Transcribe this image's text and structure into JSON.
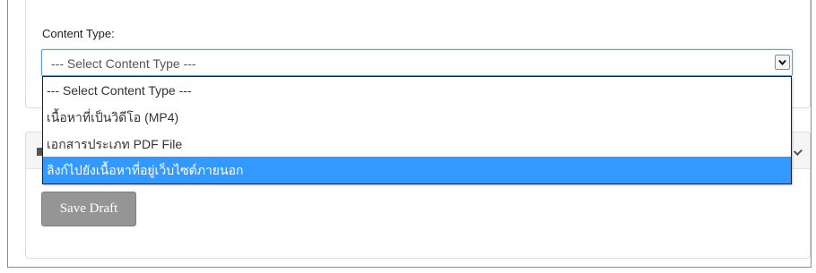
{
  "form": {
    "content_type_label": "Content Type:",
    "select_value": "--- Select Content Type ---",
    "options": [
      "--- Select Content Type ---",
      "เนื้อหาที่เป็นวิดีโอ (MP4)",
      "เอกสารประเภท PDF File",
      "ลิงก์ไปยังเนื้อหาที่อยู่เว็บไซต์ภายนอก"
    ],
    "highlighted_option": "ลิงก์ไปยังเนื้อหาที่อยู่เว็บไซต์ภายนอก",
    "save_draft_label": "Save Draft"
  },
  "icons": {
    "select_arrow": "chevron-down-icon",
    "panel_left": "edit-icon",
    "panel_right": "chevron-down-icon"
  },
  "colors": {
    "highlight": "#3399ff",
    "focus_border": "#5b9dd9",
    "button": "#959595"
  }
}
